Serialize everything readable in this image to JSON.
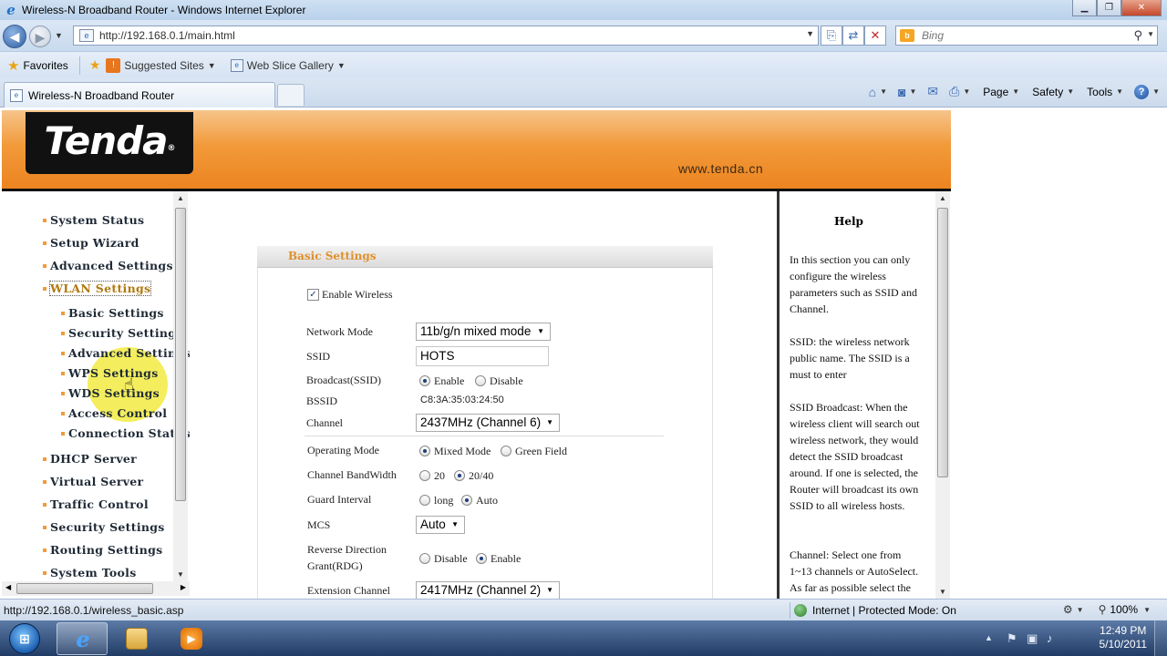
{
  "window": {
    "title": "Wireless-N Broadband Router - Windows Internet Explorer"
  },
  "address_bar": {
    "url": "http://192.168.0.1/main.html"
  },
  "search": {
    "placeholder": "Bing"
  },
  "favorites_bar": {
    "favorites_label": "Favorites",
    "links": [
      "Suggested Sites",
      "Web Slice Gallery"
    ]
  },
  "tabs": [
    {
      "label": "Wireless-N Broadband Router"
    }
  ],
  "command_bar": {
    "page": "Page",
    "safety": "Safety",
    "tools": "Tools"
  },
  "banner": {
    "logo": "Tenda",
    "site_url": "www.tenda.cn"
  },
  "nav": {
    "items": [
      "System Status",
      "Setup Wizard",
      "Advanced Settings",
      "WLAN Settings"
    ],
    "sub_items": [
      "Basic Settings",
      "Security Settings",
      "Advanced Settings",
      "WPS Settings",
      "WDS Settings",
      "Access Control",
      "Connection Status"
    ],
    "items_after": [
      "DHCP Server",
      "Virtual Server",
      "Traffic Control",
      "Security Settings",
      "Routing Settings",
      "System Tools"
    ]
  },
  "basic": {
    "section_title": "Basic Settings",
    "enable_wireless_label": "Enable Wireless",
    "enable_wireless": true,
    "network_mode_label": "Network Mode",
    "network_mode": "11b/g/n mixed mode",
    "ssid_label": "SSID",
    "ssid": "HOTS",
    "broadcast_label": "Broadcast(SSID)",
    "broadcast_enable": "Enable",
    "broadcast_disable": "Disable",
    "bssid_label": "BSSID",
    "bssid": "C8:3A:35:03:24:50",
    "channel_label": "Channel",
    "channel": "2437MHz (Channel 6)",
    "operating_mode_label": "Operating Mode",
    "operating_mixed": "Mixed Mode",
    "operating_green": "Green Field",
    "bandwidth_label": "Channel BandWidth",
    "bandwidth_20": "20",
    "bandwidth_2040": "20/40",
    "guard_label": "Guard Interval",
    "guard_long": "long",
    "guard_auto": "Auto",
    "mcs_label": "MCS",
    "mcs": "Auto",
    "rdg_label_1": "Reverse Direction",
    "rdg_label_2": "Grant(RDG)",
    "rdg_disable": "Disable",
    "rdg_enable": "Enable",
    "ext_channel_label": "Extension Channel",
    "ext_channel": "2417MHz (Channel 2)"
  },
  "help": {
    "title": "Help",
    "paragraphs": [
      "In this section you can only configure the wireless parameters such as SSID and Channel.",
      "SSID: the wireless network public name. The SSID is a must to enter",
      "SSID Broadcast: When the wireless client will search out wireless network, they would detect the SSID broadcast around. If one is selected, the Router will broadcast its own SSID to all wireless hosts.",
      "Channel: Select one from 1~13 channels or AutoSelect. As far as possible select the"
    ]
  },
  "status_bar": {
    "url": "http://192.168.0.1/wireless_basic.asp",
    "zone": "Internet | Protected Mode: On",
    "zoom": "100%"
  },
  "taskbar": {
    "time": "12:49 PM",
    "date": "5/10/2011"
  }
}
